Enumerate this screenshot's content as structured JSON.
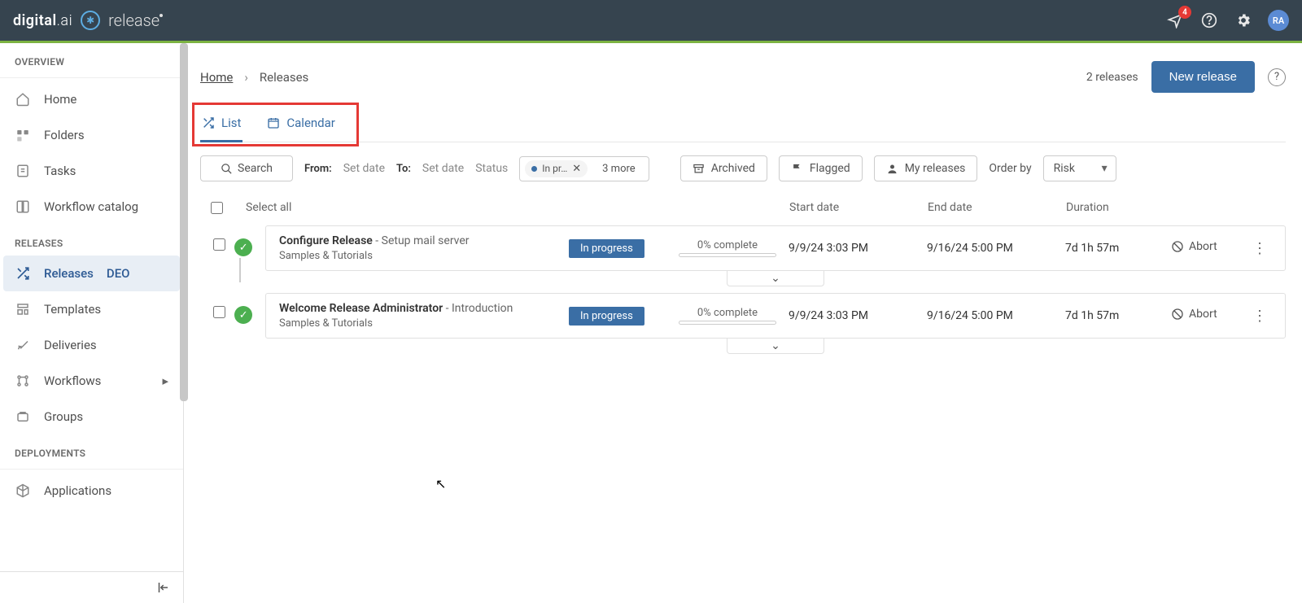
{
  "header": {
    "brand_prefix": "digital",
    "brand_suffix": ".ai",
    "product": "release",
    "notification_count": "4",
    "avatar": "RA"
  },
  "sidebar": {
    "sections": {
      "overview": "OVERVIEW",
      "releases": "RELEASES",
      "deployments": "DEPLOYMENTS"
    },
    "items": {
      "home": "Home",
      "folders": "Folders",
      "tasks": "Tasks",
      "workflow_catalog": "Workflow catalog",
      "releases": "Releases",
      "templates": "Templates",
      "deliveries": "Deliveries",
      "workflows": "Workflows",
      "groups": "Groups",
      "applications": "Applications"
    }
  },
  "breadcrumbs": {
    "home": "Home",
    "current": "Releases"
  },
  "summary": {
    "count": "2 releases",
    "new_button": "New release"
  },
  "tabs": {
    "list": "List",
    "calendar": "Calendar"
  },
  "filters": {
    "search": "Search",
    "from_label": "From:",
    "from_value": "Set date",
    "to_label": "To:",
    "to_value": "Set date",
    "status_label": "Status",
    "status_chip": "In pr…",
    "more": "3 more",
    "archived": "Archived",
    "flagged": "Flagged",
    "my_releases": "My releases",
    "order_by_label": "Order by",
    "order_by_value": "Risk"
  },
  "table": {
    "select_all": "Select all",
    "start_date": "Start date",
    "end_date": "End date",
    "duration": "Duration"
  },
  "rows": [
    {
      "title": "Configure Release",
      "subtitle": " - Setup mail server",
      "folder": "Samples & Tutorials",
      "state": "In progress",
      "progress": "0% complete",
      "start": "9/9/24 3:03 PM",
      "end": "9/16/24 5:00 PM",
      "duration": "7d 1h 57m",
      "abort": "Abort"
    },
    {
      "title": "Welcome Release Administrator",
      "subtitle": " - Introduction",
      "folder": "Samples & Tutorials",
      "state": "In progress",
      "progress": "0% complete",
      "start": "9/9/24 3:03 PM",
      "end": "9/16/24 5:00 PM",
      "duration": "7d 1h 57m",
      "abort": "Abort"
    }
  ]
}
